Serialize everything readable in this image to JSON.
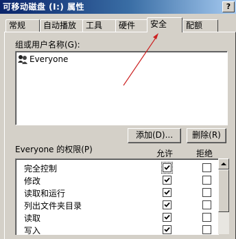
{
  "window": {
    "title": "可移动磁盘 (I:) 属性",
    "help_label": "?"
  },
  "tabs": [
    {
      "label": "常规",
      "active": false
    },
    {
      "label": "自动播放",
      "active": false
    },
    {
      "label": "工具",
      "active": false
    },
    {
      "label": "硬件",
      "active": false
    },
    {
      "label": "安全",
      "active": true
    },
    {
      "label": "配额",
      "active": false
    }
  ],
  "security": {
    "groups_label": "组或用户名称(G):",
    "users": [
      {
        "name": "Everyone",
        "icon": "users-group-icon",
        "selected": false
      }
    ],
    "add_button": "添加(D)...",
    "remove_button": "删除(R)",
    "permissions_label": "Everyone 的权限(P)",
    "allow_header": "允许",
    "deny_header": "拒绝",
    "permissions": [
      {
        "name": "完全控制",
        "allow": true,
        "deny": false,
        "focused": true
      },
      {
        "name": "修改",
        "allow": true,
        "deny": false,
        "focused": false
      },
      {
        "name": "读取和运行",
        "allow": true,
        "deny": false,
        "focused": false
      },
      {
        "name": "列出文件夹目录",
        "allow": true,
        "deny": false,
        "focused": false
      },
      {
        "name": "读取",
        "allow": true,
        "deny": false,
        "focused": false
      },
      {
        "name": "写入",
        "allow": true,
        "deny": false,
        "focused": false
      }
    ]
  },
  "colors": {
    "titlebar_start": "#0a246a",
    "titlebar_end": "#a6caf0",
    "dialog_bg": "#d4d0c8",
    "annotation_arrow": "#cc2222"
  }
}
